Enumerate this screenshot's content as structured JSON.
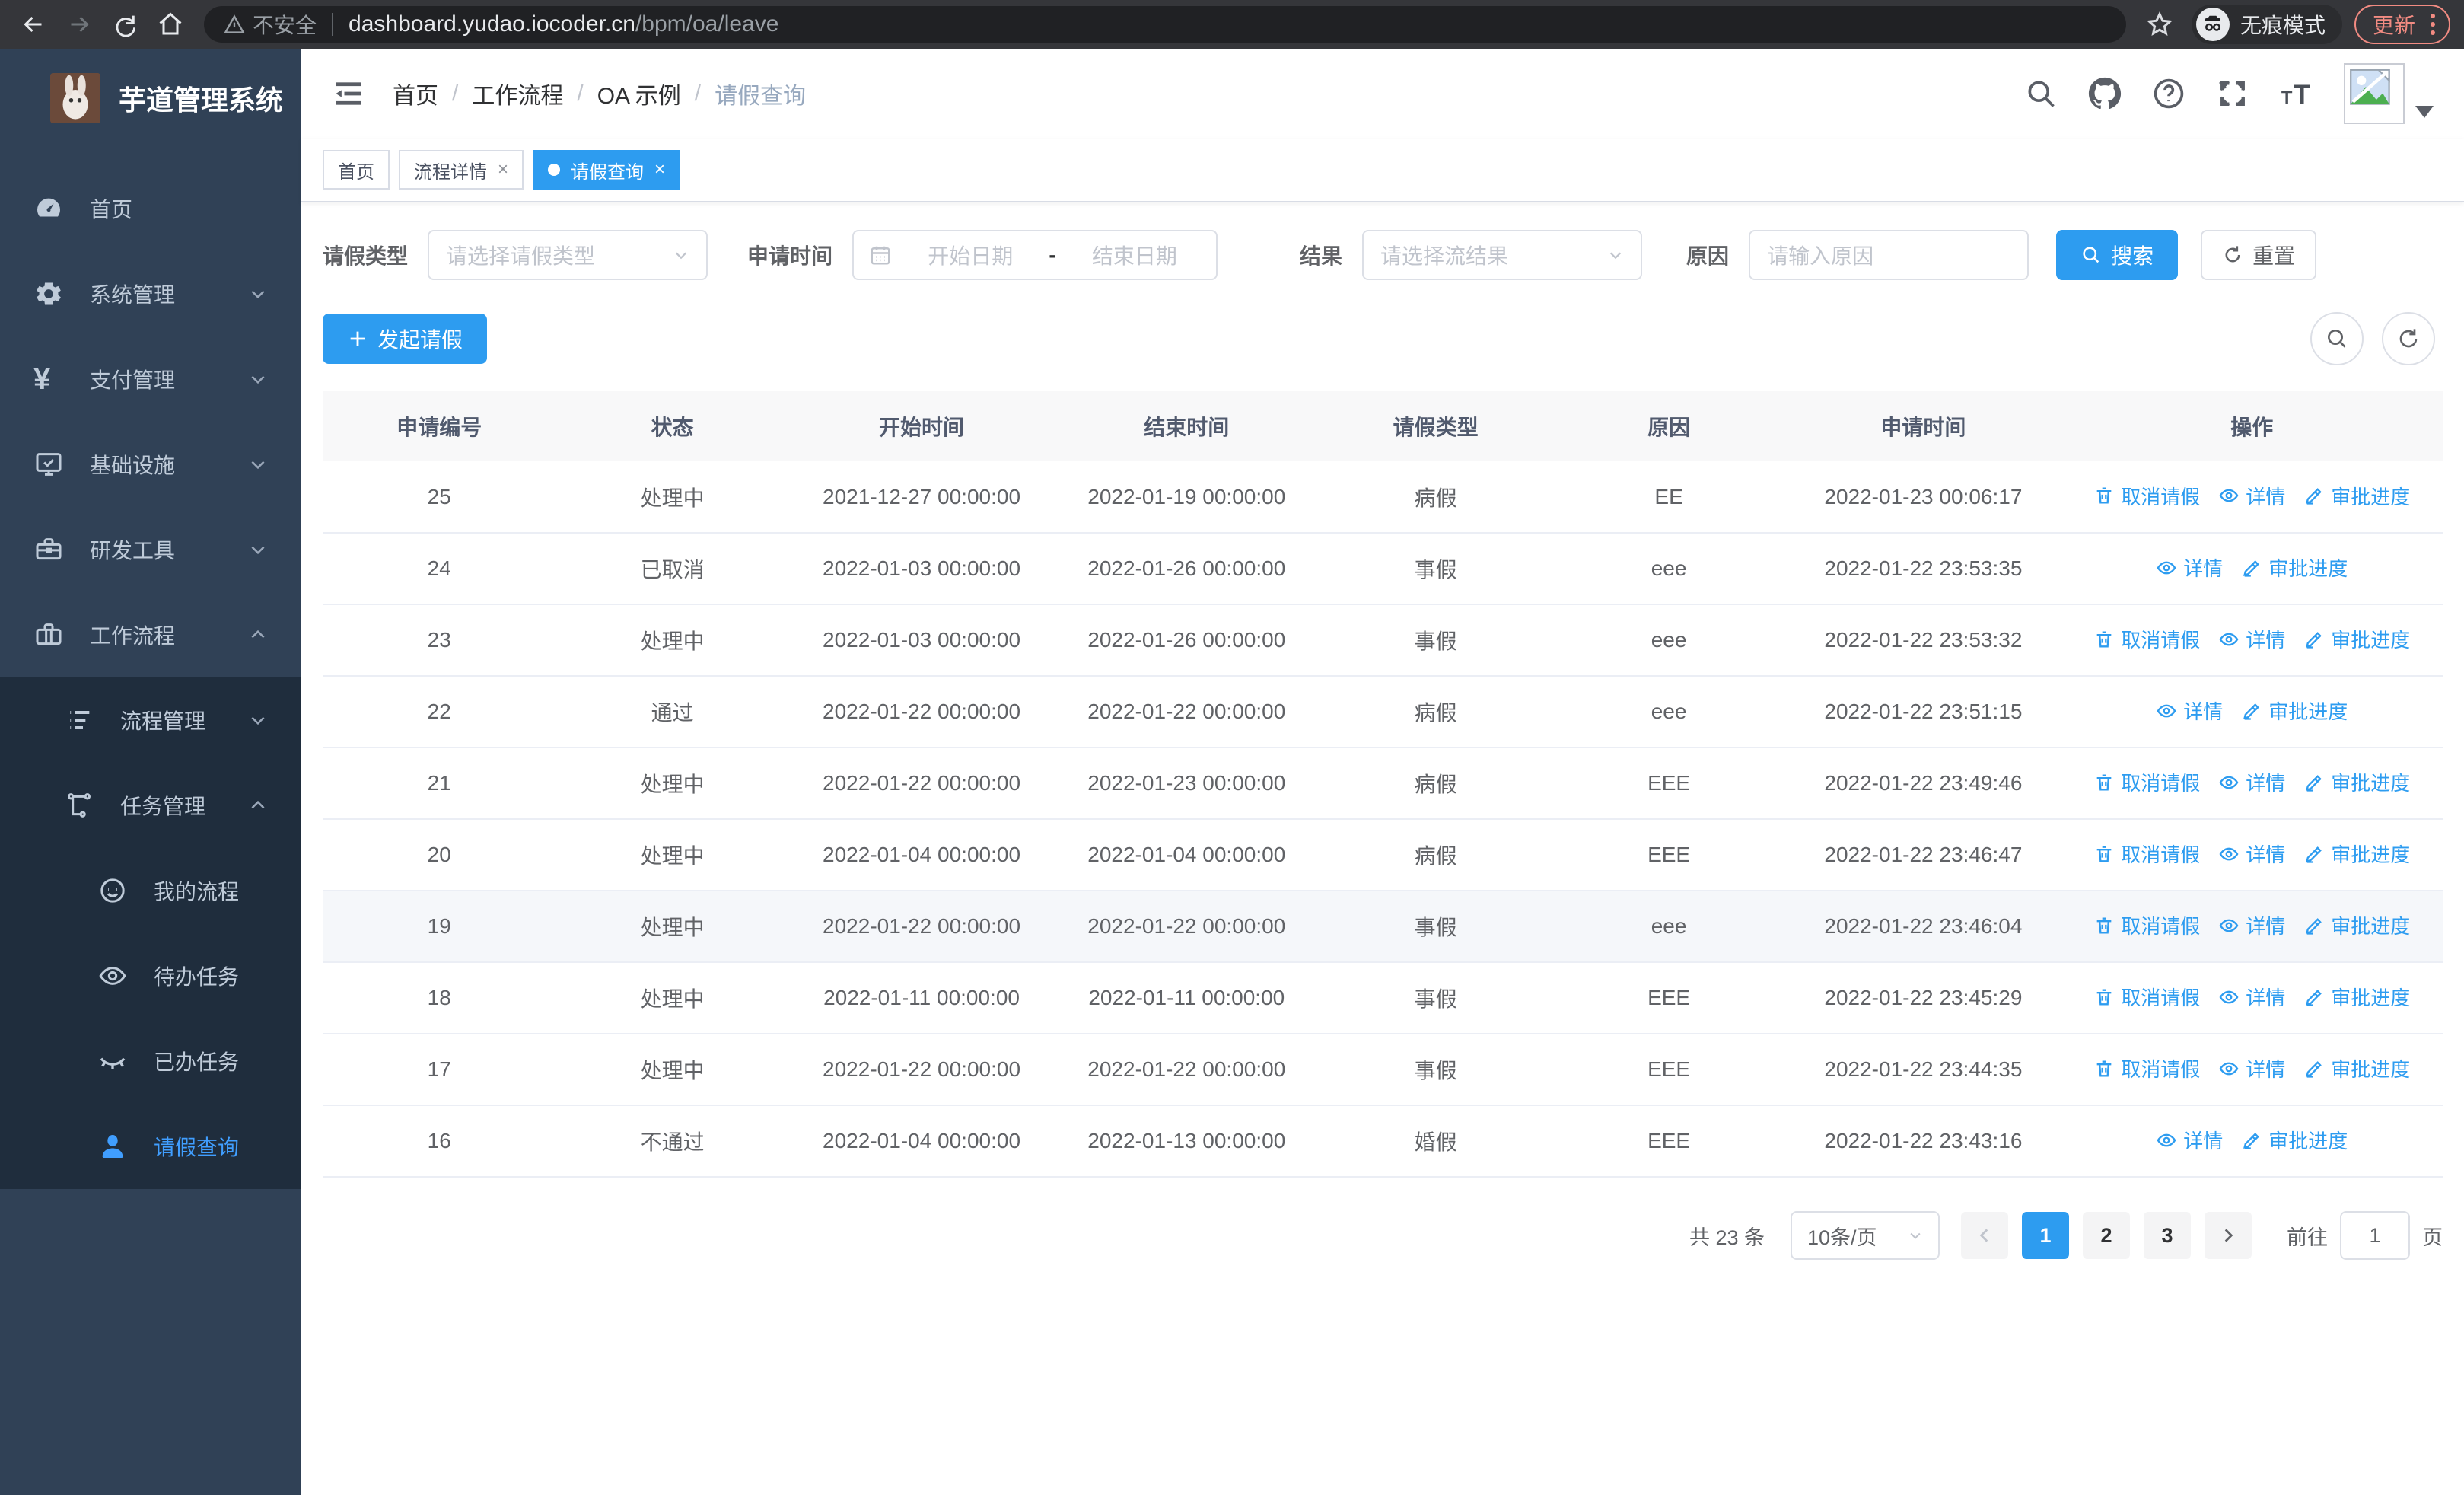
{
  "browser": {
    "security_warning": "不安全",
    "url_host": "dashboard.yudao.iocoder.cn",
    "url_path": "/bpm/oa/leave",
    "incognito_label": "无痕模式",
    "update_label": "更新"
  },
  "app": {
    "title": "芋道管理系统"
  },
  "sidebar": {
    "top": [
      {
        "key": "home",
        "label": "首页",
        "icon": "dashboard-icon",
        "arrow": "none"
      },
      {
        "key": "system",
        "label": "系统管理",
        "icon": "gear-icon",
        "arrow": "down"
      },
      {
        "key": "payment",
        "label": "支付管理",
        "icon": "yen-icon",
        "arrow": "down"
      },
      {
        "key": "infra",
        "label": "基础设施",
        "icon": "monitor-icon",
        "arrow": "down"
      },
      {
        "key": "devtools",
        "label": "研发工具",
        "icon": "toolbox-icon",
        "arrow": "down"
      },
      {
        "key": "workflow",
        "label": "工作流程",
        "icon": "briefcase-icon",
        "arrow": "up"
      }
    ],
    "submenu": [
      {
        "key": "process-mgmt",
        "label": "流程管理",
        "icon": "list-icon",
        "arrow": "down",
        "level": 2
      },
      {
        "key": "task-mgmt",
        "label": "任务管理",
        "icon": "flow-icon",
        "arrow": "up",
        "level": 2
      },
      {
        "key": "my-process",
        "label": "我的流程",
        "icon": "face-icon",
        "arrow": "none",
        "level": 3
      },
      {
        "key": "todo-tasks",
        "label": "待办任务",
        "icon": "eye-icon",
        "arrow": "none",
        "level": 3
      },
      {
        "key": "done-tasks",
        "label": "已办任务",
        "icon": "eye-closed-icon",
        "arrow": "none",
        "level": 3
      },
      {
        "key": "leave-query",
        "label": "请假查询",
        "icon": "user-icon",
        "arrow": "none",
        "level": 3,
        "active": true
      }
    ]
  },
  "breadcrumb": [
    "首页",
    "工作流程",
    "OA 示例",
    "请假查询"
  ],
  "tabs": [
    {
      "label": "首页",
      "closable": false,
      "active": false
    },
    {
      "label": "流程详情",
      "closable": true,
      "active": false
    },
    {
      "label": "请假查询",
      "closable": true,
      "active": true
    }
  ],
  "filters": {
    "leave_type_label": "请假类型",
    "leave_type_placeholder": "请选择请假类型",
    "apply_time_label": "申请时间",
    "start_date_placeholder": "开始日期",
    "range_separator": "-",
    "end_date_placeholder": "结束日期",
    "result_label": "结果",
    "result_placeholder": "请选择流结果",
    "reason_label": "原因",
    "reason_placeholder": "请输入原因",
    "search_label": "搜索",
    "reset_label": "重置"
  },
  "toolbar": {
    "create_label": "发起请假"
  },
  "table": {
    "columns": [
      "申请编号",
      "状态",
      "开始时间",
      "结束时间",
      "请假类型",
      "原因",
      "申请时间",
      "操作"
    ],
    "action_labels": {
      "cancel": "取消请假",
      "detail": "详情",
      "progress": "审批进度"
    },
    "rows": [
      {
        "id": "25",
        "status": "处理中",
        "start": "2021-12-27 00:00:00",
        "end": "2022-01-19 00:00:00",
        "type": "病假",
        "reason": "EE",
        "applied": "2022-01-23 00:06:17",
        "actions": [
          "cancel",
          "detail",
          "progress"
        ],
        "highlighted": false
      },
      {
        "id": "24",
        "status": "已取消",
        "start": "2022-01-03 00:00:00",
        "end": "2022-01-26 00:00:00",
        "type": "事假",
        "reason": "eee",
        "applied": "2022-01-22 23:53:35",
        "actions": [
          "detail",
          "progress"
        ],
        "highlighted": false
      },
      {
        "id": "23",
        "status": "处理中",
        "start": "2022-01-03 00:00:00",
        "end": "2022-01-26 00:00:00",
        "type": "事假",
        "reason": "eee",
        "applied": "2022-01-22 23:53:32",
        "actions": [
          "cancel",
          "detail",
          "progress"
        ],
        "highlighted": false
      },
      {
        "id": "22",
        "status": "通过",
        "start": "2022-01-22 00:00:00",
        "end": "2022-01-22 00:00:00",
        "type": "病假",
        "reason": "eee",
        "applied": "2022-01-22 23:51:15",
        "actions": [
          "detail",
          "progress"
        ],
        "highlighted": false
      },
      {
        "id": "21",
        "status": "处理中",
        "start": "2022-01-22 00:00:00",
        "end": "2022-01-23 00:00:00",
        "type": "病假",
        "reason": "EEE",
        "applied": "2022-01-22 23:49:46",
        "actions": [
          "cancel",
          "detail",
          "progress"
        ],
        "highlighted": false
      },
      {
        "id": "20",
        "status": "处理中",
        "start": "2022-01-04 00:00:00",
        "end": "2022-01-04 00:00:00",
        "type": "病假",
        "reason": "EEE",
        "applied": "2022-01-22 23:46:47",
        "actions": [
          "cancel",
          "detail",
          "progress"
        ],
        "highlighted": false
      },
      {
        "id": "19",
        "status": "处理中",
        "start": "2022-01-22 00:00:00",
        "end": "2022-01-22 00:00:00",
        "type": "事假",
        "reason": "eee",
        "applied": "2022-01-22 23:46:04",
        "actions": [
          "cancel",
          "detail",
          "progress"
        ],
        "highlighted": true
      },
      {
        "id": "18",
        "status": "处理中",
        "start": "2022-01-11 00:00:00",
        "end": "2022-01-11 00:00:00",
        "type": "事假",
        "reason": "EEE",
        "applied": "2022-01-22 23:45:29",
        "actions": [
          "cancel",
          "detail",
          "progress"
        ],
        "highlighted": false
      },
      {
        "id": "17",
        "status": "处理中",
        "start": "2022-01-22 00:00:00",
        "end": "2022-01-22 00:00:00",
        "type": "事假",
        "reason": "EEE",
        "applied": "2022-01-22 23:44:35",
        "actions": [
          "cancel",
          "detail",
          "progress"
        ],
        "highlighted": false
      },
      {
        "id": "16",
        "status": "不通过",
        "start": "2022-01-04 00:00:00",
        "end": "2022-01-13 00:00:00",
        "type": "婚假",
        "reason": "EEE",
        "applied": "2022-01-22 23:43:16",
        "actions": [
          "detail",
          "progress"
        ],
        "highlighted": false
      }
    ]
  },
  "pagination": {
    "total": "共 23 条",
    "page_size": "10条/页",
    "pages": [
      "1",
      "2",
      "3"
    ],
    "active_page": "1",
    "goto_label": "前往",
    "goto_value": "1",
    "page_suffix": "页"
  },
  "colors": {
    "primary": "#2d9cf0",
    "sidebar_bg": "#304156",
    "submenu_bg": "#1f2d3d",
    "update_coral": "#f28b82"
  }
}
